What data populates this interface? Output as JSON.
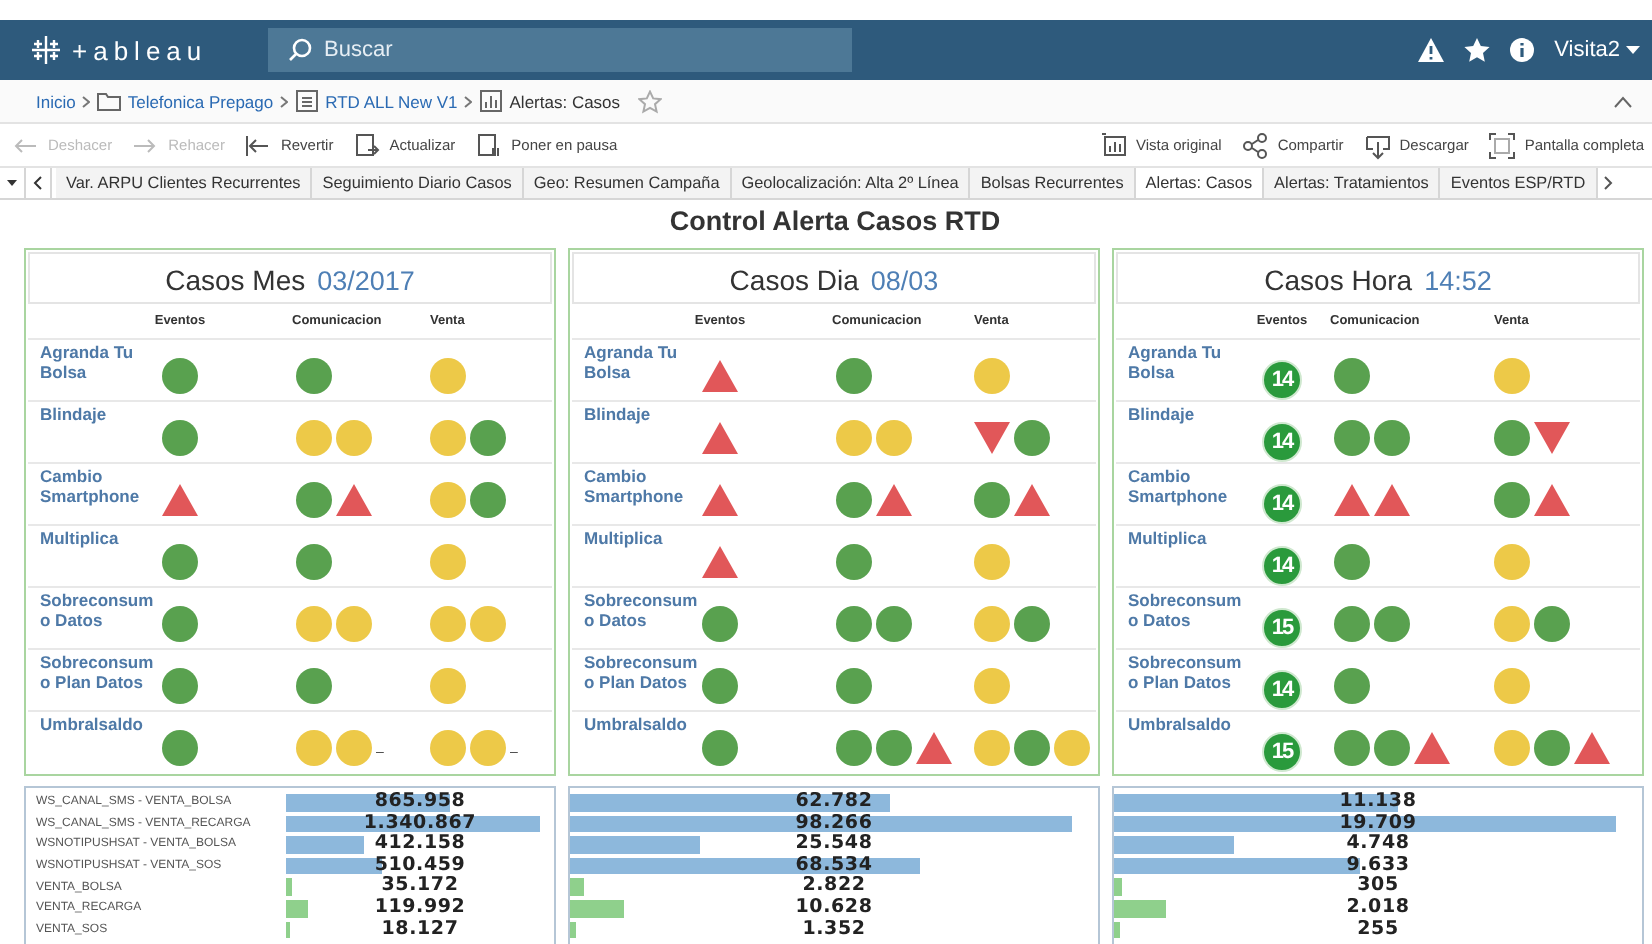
{
  "topbar": {
    "logo": "+ableau",
    "search": {
      "placeholder": "Buscar"
    },
    "user": "Visita2"
  },
  "breadcrumb": {
    "items": [
      {
        "label": "Inicio",
        "kind": "link"
      },
      {
        "label": "Telefonica Prepago",
        "kind": "folder"
      },
      {
        "label": "RTD ALL New V1",
        "kind": "workbook"
      },
      {
        "label": "Alertas: Casos",
        "kind": "sheet"
      }
    ],
    "favorite": false
  },
  "toolbar": {
    "left": [
      {
        "label": "Deshacer",
        "kind": "undo",
        "disabled": true
      },
      {
        "label": "Rehacer",
        "kind": "redo",
        "disabled": true
      },
      {
        "label": "Revertir",
        "kind": "revert",
        "disabled": false
      },
      {
        "label": "Actualizar",
        "kind": "refresh",
        "disabled": false
      },
      {
        "label": "Poner en pausa",
        "kind": "pause",
        "disabled": false
      }
    ],
    "right": [
      {
        "label": "Vista original",
        "kind": "view",
        "disabled": false
      },
      {
        "label": "Compartir",
        "kind": "share",
        "disabled": false
      },
      {
        "label": "Descargar",
        "kind": "download",
        "disabled": false
      },
      {
        "label": "Pantalla completa",
        "kind": "fullscreen",
        "disabled": false
      }
    ]
  },
  "tabs": [
    {
      "label": "Var. ARPU Clientes Recurrentes",
      "selected": false
    },
    {
      "label": "Seguimiento Diario Casos",
      "selected": false
    },
    {
      "label": "Geo: Resumen Campaña",
      "selected": false
    },
    {
      "label": "Geolocalización: Alta 2º Línea",
      "selected": false
    },
    {
      "label": "Bolsas Recurrentes",
      "selected": false
    },
    {
      "label": "Alertas: Casos",
      "selected": true
    },
    {
      "label": "Alertas: Tratamientos",
      "selected": false
    },
    {
      "label": "Eventos ESP/RTD",
      "selected": false
    }
  ],
  "title": "Control Alerta Casos RTD",
  "panels": [
    {
      "title": "Casos Mes",
      "period": "03/2017",
      "columns": [
        "Eventos",
        "Comunicacion",
        "Venta"
      ],
      "rows": [
        {
          "label": "Agranda Tu Bolsa",
          "cells": [
            [
              {
                "kind": "dot",
                "color": "#59a14f"
              }
            ],
            [
              {
                "kind": "dot",
                "color": "#59a14f"
              }
            ],
            [
              {
                "kind": "dot",
                "color": "#edc948"
              }
            ]
          ]
        },
        {
          "label": "Blindaje",
          "cells": [
            [
              {
                "kind": "dot",
                "color": "#59a14f"
              }
            ],
            [
              {
                "kind": "dot",
                "color": "#edc948"
              },
              {
                "kind": "dot",
                "color": "#edc948"
              }
            ],
            [
              {
                "kind": "dot",
                "color": "#edc948"
              },
              {
                "kind": "dot",
                "color": "#59a14f"
              }
            ]
          ]
        },
        {
          "label": "Cambio Smartphone",
          "cells": [
            [
              {
                "kind": "up",
                "color": "#e15759"
              }
            ],
            [
              {
                "kind": "dot",
                "color": "#59a14f"
              },
              {
                "kind": "up",
                "color": "#e15759"
              }
            ],
            [
              {
                "kind": "dot",
                "color": "#edc948"
              },
              {
                "kind": "dot",
                "color": "#59a14f"
              }
            ]
          ]
        },
        {
          "label": "Multiplica",
          "cells": [
            [
              {
                "kind": "dot",
                "color": "#59a14f"
              }
            ],
            [
              {
                "kind": "dot",
                "color": "#59a14f"
              }
            ],
            [
              {
                "kind": "dot",
                "color": "#edc948"
              }
            ]
          ]
        },
        {
          "label": "Sobreconsumo Datos",
          "cells": [
            [
              {
                "kind": "dot",
                "color": "#59a14f"
              }
            ],
            [
              {
                "kind": "dot",
                "color": "#edc948"
              },
              {
                "kind": "dot",
                "color": "#edc948"
              }
            ],
            [
              {
                "kind": "dot",
                "color": "#edc948"
              },
              {
                "kind": "dot",
                "color": "#edc948"
              }
            ]
          ]
        },
        {
          "label": "Sobreconsumo Plan Datos",
          "cells": [
            [
              {
                "kind": "dot",
                "color": "#59a14f"
              }
            ],
            [
              {
                "kind": "dot",
                "color": "#59a14f"
              }
            ],
            [
              {
                "kind": "dot",
                "color": "#edc948"
              }
            ]
          ]
        },
        {
          "label": "Umbralsaldo",
          "cells": [
            [
              {
                "kind": "dot",
                "color": "#59a14f"
              }
            ],
            [
              {
                "kind": "dot",
                "color": "#edc948"
              },
              {
                "kind": "dot",
                "color": "#edc948"
              },
              {
                "kind": "dash",
                "text": "–"
              }
            ],
            [
              {
                "kind": "dot",
                "color": "#edc948"
              },
              {
                "kind": "dot",
                "color": "#edc948"
              },
              {
                "kind": "dash",
                "text": "–"
              }
            ]
          ]
        }
      ]
    },
    {
      "title": "Casos Dia",
      "period": "08/03",
      "columns": [
        "Eventos",
        "Comunicacion",
        "Venta"
      ],
      "rows": [
        {
          "label": "Agranda Tu Bolsa",
          "cells": [
            [
              {
                "kind": "up",
                "color": "#e15759"
              }
            ],
            [
              {
                "kind": "dot",
                "color": "#59a14f"
              }
            ],
            [
              {
                "kind": "dot",
                "color": "#edc948"
              }
            ]
          ]
        },
        {
          "label": "Blindaje",
          "cells": [
            [
              {
                "kind": "up",
                "color": "#e15759"
              }
            ],
            [
              {
                "kind": "dot",
                "color": "#edc948"
              },
              {
                "kind": "dot",
                "color": "#edc948"
              }
            ],
            [
              {
                "kind": "down",
                "color": "#e15759"
              },
              {
                "kind": "dot",
                "color": "#59a14f"
              }
            ]
          ]
        },
        {
          "label": "Cambio Smartphone",
          "cells": [
            [
              {
                "kind": "up",
                "color": "#e15759"
              }
            ],
            [
              {
                "kind": "dot",
                "color": "#59a14f"
              },
              {
                "kind": "up",
                "color": "#e15759"
              }
            ],
            [
              {
                "kind": "dot",
                "color": "#59a14f"
              },
              {
                "kind": "up",
                "color": "#e15759"
              }
            ]
          ]
        },
        {
          "label": "Multiplica",
          "cells": [
            [
              {
                "kind": "up",
                "color": "#e15759"
              }
            ],
            [
              {
                "kind": "dot",
                "color": "#59a14f"
              }
            ],
            [
              {
                "kind": "dot",
                "color": "#edc948"
              }
            ]
          ]
        },
        {
          "label": "Sobreconsumo Datos",
          "cells": [
            [
              {
                "kind": "dot",
                "color": "#59a14f"
              }
            ],
            [
              {
                "kind": "dot",
                "color": "#59a14f"
              },
              {
                "kind": "dot",
                "color": "#59a14f"
              }
            ],
            [
              {
                "kind": "dot",
                "color": "#edc948"
              },
              {
                "kind": "dot",
                "color": "#59a14f"
              }
            ]
          ]
        },
        {
          "label": "Sobreconsumo Plan Datos",
          "cells": [
            [
              {
                "kind": "dot",
                "color": "#59a14f"
              }
            ],
            [
              {
                "kind": "dot",
                "color": "#59a14f"
              }
            ],
            [
              {
                "kind": "dot",
                "color": "#edc948"
              }
            ]
          ]
        },
        {
          "label": "Umbralsaldo",
          "cells": [
            [
              {
                "kind": "dot",
                "color": "#59a14f"
              }
            ],
            [
              {
                "kind": "dot",
                "color": "#59a14f"
              },
              {
                "kind": "dot",
                "color": "#59a14f"
              },
              {
                "kind": "up",
                "color": "#e15759"
              }
            ],
            [
              {
                "kind": "dot",
                "color": "#edc948"
              },
              {
                "kind": "dot",
                "color": "#59a14f"
              },
              {
                "kind": "dot",
                "color": "#edc948"
              }
            ]
          ]
        }
      ]
    },
    {
      "title": "Casos Hora",
      "period": "14:52",
      "columns": [
        "Eventos",
        "Comunicacion",
        "Venta"
      ],
      "rows": [
        {
          "label": "Agranda Tu Bolsa",
          "cells": [
            [
              {
                "kind": "badge",
                "text": "14",
                "color": "#2a9a3c"
              }
            ],
            [
              {
                "kind": "dot",
                "color": "#59a14f"
              }
            ],
            [
              {
                "kind": "dot",
                "color": "#edc948"
              }
            ]
          ]
        },
        {
          "label": "Blindaje",
          "cells": [
            [
              {
                "kind": "badge",
                "text": "14",
                "color": "#2a9a3c"
              }
            ],
            [
              {
                "kind": "dot",
                "color": "#59a14f"
              },
              {
                "kind": "dot",
                "color": "#59a14f"
              }
            ],
            [
              {
                "kind": "dot",
                "color": "#59a14f"
              },
              {
                "kind": "down",
                "color": "#e15759"
              }
            ]
          ]
        },
        {
          "label": "Cambio Smartphone",
          "cells": [
            [
              {
                "kind": "badge",
                "text": "14",
                "color": "#2a9a3c"
              }
            ],
            [
              {
                "kind": "up",
                "color": "#e15759"
              },
              {
                "kind": "up",
                "color": "#e15759"
              }
            ],
            [
              {
                "kind": "dot",
                "color": "#59a14f"
              },
              {
                "kind": "up",
                "color": "#e15759"
              }
            ]
          ]
        },
        {
          "label": "Multiplica",
          "cells": [
            [
              {
                "kind": "badge",
                "text": "14",
                "color": "#2a9a3c"
              }
            ],
            [
              {
                "kind": "dot",
                "color": "#59a14f"
              }
            ],
            [
              {
                "kind": "dot",
                "color": "#edc948"
              }
            ]
          ]
        },
        {
          "label": "Sobreconsumo Datos",
          "cells": [
            [
              {
                "kind": "badge",
                "text": "15",
                "color": "#2a9a3c"
              }
            ],
            [
              {
                "kind": "dot",
                "color": "#59a14f"
              },
              {
                "kind": "dot",
                "color": "#59a14f"
              }
            ],
            [
              {
                "kind": "dot",
                "color": "#edc948"
              },
              {
                "kind": "dot",
                "color": "#59a14f"
              }
            ]
          ]
        },
        {
          "label": "Sobreconsumo Plan Datos",
          "cells": [
            [
              {
                "kind": "badge",
                "text": "14",
                "color": "#2a9a3c"
              }
            ],
            [
              {
                "kind": "dot",
                "color": "#59a14f"
              }
            ],
            [
              {
                "kind": "dot",
                "color": "#edc948"
              }
            ]
          ]
        },
        {
          "label": "Umbralsaldo",
          "cells": [
            [
              {
                "kind": "badge",
                "text": "15",
                "color": "#2a9a3c"
              }
            ],
            [
              {
                "kind": "dot",
                "color": "#59a14f"
              },
              {
                "kind": "dot",
                "color": "#59a14f"
              },
              {
                "kind": "up",
                "color": "#e15759"
              }
            ],
            [
              {
                "kind": "dot",
                "color": "#edc948"
              },
              {
                "kind": "dot",
                "color": "#59a14f"
              },
              {
                "kind": "up",
                "color": "#e15759"
              }
            ]
          ]
        }
      ]
    }
  ],
  "bars": [
    {
      "rows": [
        {
          "label": "WS_CANAL_SMS - VENTA_BOLSA",
          "value": "865.958",
          "color": "#8db8dc"
        },
        {
          "label": "WS_CANAL_SMS - VENTA_RECARGA",
          "value": "1.340.867",
          "color": "#8db8dc"
        },
        {
          "label": "WSNOTIPUSHSAT - VENTA_BOLSA",
          "value": "412.158",
          "color": "#8db8dc"
        },
        {
          "label": "WSNOTIPUSHSAT - VENTA_SOS",
          "value": "510.459",
          "color": "#8db8dc"
        },
        {
          "label": "VENTA_BOLSA",
          "value": "35.172",
          "color": "#8fd08c"
        },
        {
          "label": "VENTA_RECARGA",
          "value": "119.992",
          "color": "#8fd08c"
        },
        {
          "label": "VENTA_SOS",
          "value": "18.127",
          "color": "#8fd08c"
        }
      ]
    },
    {
      "rows": [
        {
          "value": "62.782",
          "color": "#8db8dc"
        },
        {
          "value": "98.266",
          "color": "#8db8dc"
        },
        {
          "value": "25.548",
          "color": "#8db8dc"
        },
        {
          "value": "68.534",
          "color": "#8db8dc"
        },
        {
          "value": "2.822",
          "color": "#8fd08c"
        },
        {
          "value": "10.628",
          "color": "#8fd08c"
        },
        {
          "value": "1.352",
          "color": "#8fd08c"
        }
      ]
    },
    {
      "rows": [
        {
          "value": "11.138",
          "color": "#8db8dc"
        },
        {
          "value": "19.709",
          "color": "#8db8dc"
        },
        {
          "value": "4.748",
          "color": "#8db8dc"
        },
        {
          "value": "9.633",
          "color": "#8db8dc"
        },
        {
          "value": "305",
          "color": "#8fd08c"
        },
        {
          "value": "2.018",
          "color": "#8fd08c"
        },
        {
          "value": "255",
          "color": "#8fd08c"
        }
      ]
    }
  ]
}
